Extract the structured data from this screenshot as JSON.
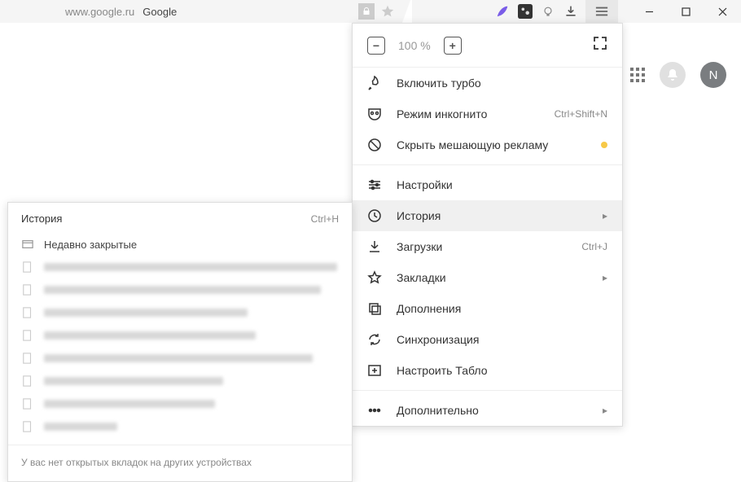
{
  "window": {
    "minimize": "—",
    "maximize": "□",
    "close": "×"
  },
  "address": {
    "host": "www.google.ru",
    "title": "Google"
  },
  "page": {
    "avatar_initial": "N"
  },
  "zoom": {
    "value": "100 %"
  },
  "menu": {
    "turbo": "Включить турбо",
    "incognito": "Режим инкогнито",
    "incognito_shortcut": "Ctrl+Shift+N",
    "hide_ads": "Скрыть мешающую рекламу",
    "settings": "Настройки",
    "history": "История",
    "downloads": "Загрузки",
    "downloads_shortcut": "Ctrl+J",
    "bookmarks": "Закладки",
    "addons": "Дополнения",
    "sync": "Синхронизация",
    "tableau": "Настроить Табло",
    "more": "Дополнительно"
  },
  "history_panel": {
    "title": "История",
    "shortcut": "Ctrl+H",
    "recently_closed": "Недавно закрытые",
    "footer": "У вас нет открытых вкладок на других устройствах",
    "blur_widths": [
      360,
      340,
      250,
      260,
      330,
      220,
      210,
      90
    ]
  }
}
